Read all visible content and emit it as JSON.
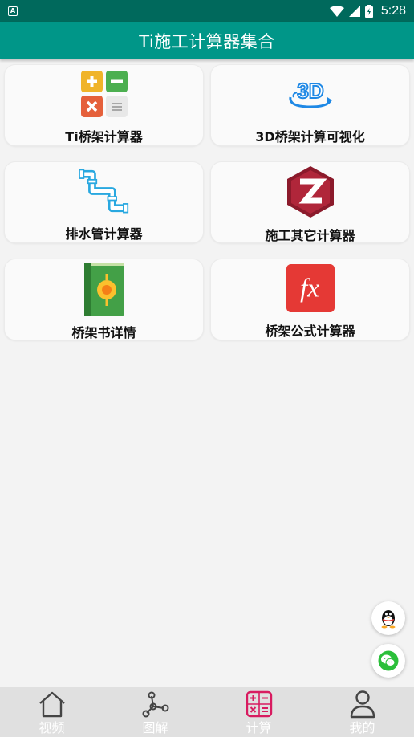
{
  "status_bar": {
    "time": "5:28",
    "notif_letter": "A"
  },
  "app_bar": {
    "title": "Ti施工计算器集合"
  },
  "cards": [
    {
      "label": "Ti桥架计算器",
      "icon": "calculator-icon"
    },
    {
      "label": "3D桥架计算可视化",
      "icon": "3d-icon"
    },
    {
      "label": "排水管计算器",
      "icon": "pipe-icon"
    },
    {
      "label": "施工其它计算器",
      "icon": "z-logo-icon"
    },
    {
      "label": "桥架书详情",
      "icon": "book-icon"
    },
    {
      "label": "桥架公式计算器",
      "icon": "fx-icon"
    }
  ],
  "fab": {
    "qq": "qq-penguin-icon",
    "wechat": "wechat-icon"
  },
  "bottom_nav": [
    {
      "label": "视频",
      "icon": "home-icon",
      "active": false
    },
    {
      "label": "图解",
      "icon": "graph-nodes-icon",
      "active": false
    },
    {
      "label": "计算",
      "icon": "calculator-icon",
      "active": true
    },
    {
      "label": "我的",
      "icon": "person-icon",
      "active": false
    }
  ],
  "colors": {
    "status_bar": "#00695c",
    "app_bar": "#009688",
    "active_nav": "#d81b60",
    "nav_bg": "#e0e0e0"
  }
}
